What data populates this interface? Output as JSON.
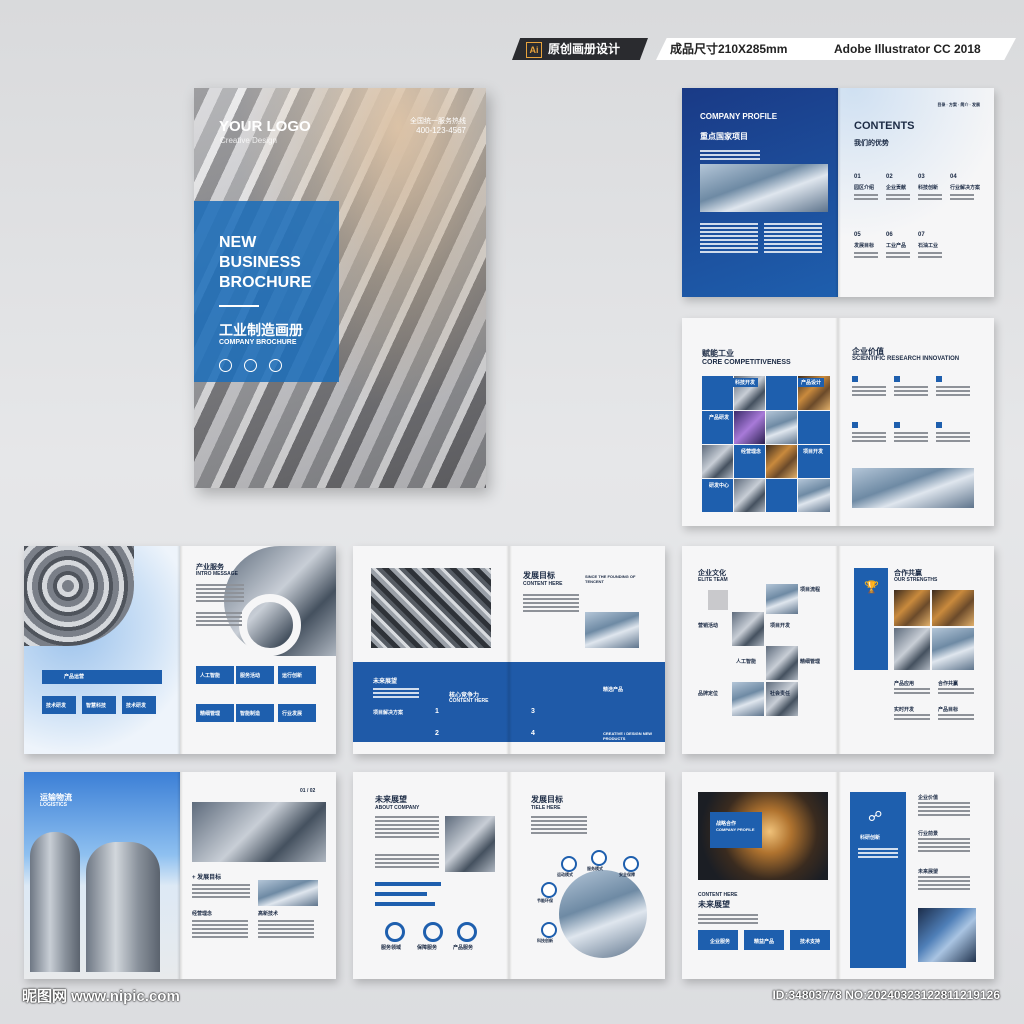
{
  "header": {
    "ai_icon": "Ai",
    "tag1": "原创画册设计",
    "tag2": "成品尺寸210X285mm",
    "tag3": "Adobe Illustrator CC 2018"
  },
  "cover": {
    "logo": "YOUR LOGO",
    "logo_sub": "Creative Design",
    "phone_label": "全国统一服务热线",
    "phone": "400-123-4567",
    "title": "NEW BUSINESS BROCHURE",
    "title_cn": "工业制造画册",
    "title_en": "COMPANY BROCHURE"
  },
  "spread1": {
    "left_title": "COMPANY PROFILE",
    "left_sub": "重点国家项目",
    "right_title": "CONTENTS",
    "right_sub": "我们的优势",
    "contents": [
      {
        "no": "01",
        "label": "园区介绍"
      },
      {
        "no": "02",
        "label": "企业贡献"
      },
      {
        "no": "03",
        "label": "科技创新"
      },
      {
        "no": "04",
        "label": "行业解决方案"
      },
      {
        "no": "05",
        "label": "发展目标"
      },
      {
        "no": "06",
        "label": "工业产品"
      },
      {
        "no": "07",
        "label": "石油工业"
      }
    ],
    "top_right_small": "目录 · 方案 · 简介 · 发展"
  },
  "spread2": {
    "left_title_cn": "赋能工业",
    "left_title_en": "CORE COMPETITIVENESS",
    "right_title_cn": "企业价值",
    "right_title_en": "SCIENTIFIC RESEARCH INNOVATION",
    "chips": [
      "科技开发",
      "产品设计",
      "产品研发",
      "经营理念",
      "项目开发",
      "研发中心"
    ]
  },
  "spread3": {
    "title_cn": "产业服务",
    "title_en": "INTRO MESSAGE",
    "items": [
      "产品运营",
      "人工智能",
      "服务活动",
      "运行创新",
      "精细管理",
      "智能制造",
      "行业发展",
      "技术研发",
      "智慧科技"
    ]
  },
  "spread4": {
    "left_band": "未来展望",
    "sub_band": "项目解决方案",
    "title_cn": "发展目标",
    "title_en": "CONTENT HERE",
    "right_en": "SINCE THE FOUNDING OF TENCENT",
    "mid_cn": "核心竞争力",
    "mid_en": "CONTENT HERE",
    "right_band": "精选产品",
    "right_band_en": "CREATIVE / DESIGN NEW PRODUCTS",
    "numbers": [
      "1",
      "2",
      "3",
      "4"
    ]
  },
  "spread5": {
    "title_cn": "企业文化",
    "title_en": "ELITE TEAM",
    "items": [
      "项目流程",
      "项目开发",
      "营销活动",
      "人工智能",
      "精细管理",
      "品牌定位",
      "社会责任"
    ],
    "right_title": "合作共赢",
    "right_en": "OUR STRENGTHS",
    "right_items": [
      "产品应用",
      "合作共赢",
      "实时开发",
      "产品目标"
    ]
  },
  "spread6": {
    "title_cn": "运输物流",
    "title_en": "LOGISTICS",
    "page": "01 / 02",
    "goal": "+ 发展目标",
    "items": [
      "经营理念",
      "高新技术"
    ]
  },
  "spread7": {
    "left_title_cn": "未来展望",
    "left_title_en": "ABOUT COMPANY",
    "right_title_cn": "发展目标",
    "right_title_en": "TIELE HERE",
    "icons": [
      "服务领域",
      "保障服务",
      "产品服务"
    ],
    "circle_items": [
      "运动模式",
      "服务模式",
      "安全保障",
      "节能环保",
      "科技创新"
    ]
  },
  "spread8": {
    "left_title_cn": "战略合作",
    "left_title_en": "COMPANY PROFILE",
    "content": "CONTENT HERE",
    "future": "未来展望",
    "bottom_items": [
      "企业服务",
      "精益产品",
      "技术支持"
    ],
    "right_center": "科研创新",
    "right_items": [
      "企业价值",
      "行业前景",
      "未来展望"
    ]
  },
  "footer": {
    "watermark": "昵图网 www.nipic.com",
    "id": "ID:34803778 NO:20240323122811219126"
  }
}
